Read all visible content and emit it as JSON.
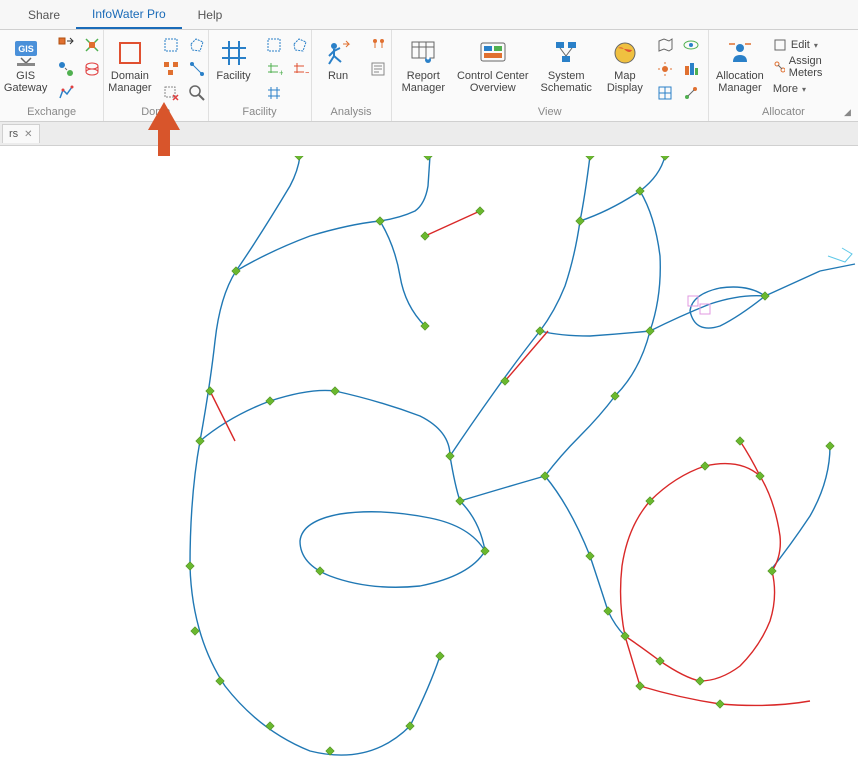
{
  "tabs": {
    "share": "Share",
    "infowater": "InfoWater Pro",
    "help": "Help"
  },
  "groups": {
    "exchange": "Exchange",
    "domain": "Doma",
    "facility": "Facility",
    "analysis": "Analysis",
    "view": "View",
    "allocator": "Allocator"
  },
  "buttons": {
    "gis_gateway": "GIS\nGateway",
    "domain_manager": "Domain\nManager",
    "facility": "Facility",
    "run": "Run",
    "report_manager": "Report\nManager",
    "control_center_overview": "Control Center\nOverview",
    "system_schematic": "System\nSchematic",
    "map_display": "Map\nDisplay",
    "allocation_manager": "Allocation\nManager",
    "edit": "Edit",
    "assign_meters": "Assign Meters",
    "more": "More"
  },
  "doc_tab": {
    "label": "rs"
  }
}
